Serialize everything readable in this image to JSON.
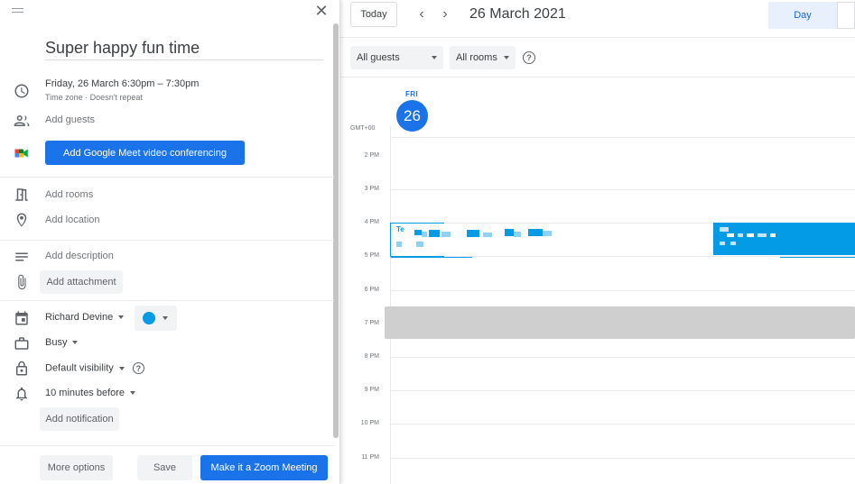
{
  "editor": {
    "title": "Super happy fun time",
    "date_line": "Friday, 26 March    6:30pm  –  7:30pm",
    "date_sub": "Time zone  ·  Doesn't repeat",
    "add_guests": "Add guests",
    "meet_button": "Add Google Meet video conferencing",
    "add_rooms": "Add rooms",
    "add_location": "Add location",
    "add_description": "Add description",
    "add_attachment": "Add attachment",
    "calendar_owner": "Richard Devine",
    "calendar_color": "#039be5",
    "busy_status": "Busy",
    "visibility": "Default visibility",
    "notification": "10 minutes before",
    "add_notification": "Add notification",
    "more_options": "More options",
    "save": "Save",
    "zoom_button": "Make it a Zoom Meeting"
  },
  "calendar": {
    "today": "Today",
    "date_title": "26 March 2021",
    "view": "Day",
    "guests_filter": "All guests",
    "rooms_filter": "All rooms",
    "day_name": "FRI",
    "day_number": "26",
    "timezone": "GMT+00",
    "hours": [
      "2 PM",
      "3 PM",
      "4 PM",
      "5 PM",
      "6 PM",
      "7 PM",
      "8 PM",
      "9 PM",
      "10 PM",
      "11 PM"
    ],
    "event_a_title": "Te"
  },
  "colors": {
    "accent": "#1a73e8",
    "event": "#039be5"
  }
}
